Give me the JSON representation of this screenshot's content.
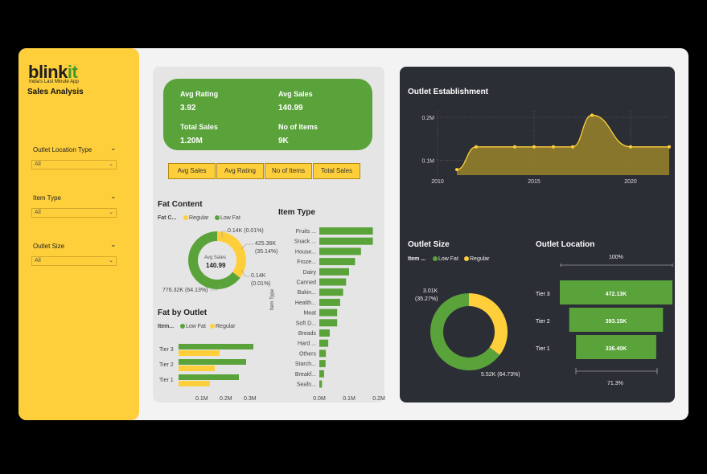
{
  "brand": {
    "logo_main": "blink",
    "logo_accent": "it",
    "tagline": "India's Last Minute App",
    "title": "Sales Analysis"
  },
  "slicers": [
    {
      "label": "Outlet Location Type",
      "value": "All"
    },
    {
      "label": "Item Type",
      "value": "All"
    },
    {
      "label": "Outlet Size",
      "value": "All"
    }
  ],
  "kpis": {
    "avg_rating_label": "Avg Rating",
    "avg_rating_value": "3.92",
    "avg_sales_label": "Avg Sales",
    "avg_sales_value": "140.99",
    "total_sales_label": "Total Sales",
    "total_sales_value": "1.20M",
    "no_items_label": "No of Items",
    "no_items_value": "9K"
  },
  "buttons": [
    "Avg Sales",
    "Avg Rating",
    "No of Items",
    "Total Sales"
  ],
  "colors": {
    "green": "#5aa33b",
    "yellow": "#fecf3b",
    "dark": "#2c2e36"
  },
  "fat_content": {
    "title": "Fat Content",
    "legend_title": "Fat C...",
    "center_label": "Avg Sales",
    "center_value": "140.99",
    "annotations": [
      "0.14K (0.01%)",
      "425.36K",
      "(35.14%)",
      "0.14K",
      "(0.01%)",
      "776.32K (64.13%)"
    ]
  },
  "fat_by_outlet": {
    "title": "Fat by Outlet",
    "legend_title": "Item..."
  },
  "item_type": {
    "title": "Item Type",
    "axis_title": "Item Type"
  },
  "outlet_establishment": {
    "title": "Outlet Establishment"
  },
  "outlet_size": {
    "title": "Outlet Size",
    "legend_title": "Item ...",
    "annotations": [
      "3.01K",
      "(35.27%)",
      "5.52K (64.73%)"
    ]
  },
  "outlet_location": {
    "title": "Outlet Location",
    "top_label": "100%",
    "bottom_label": "71.3%"
  },
  "legend": {
    "low_fat": "Low Fat",
    "regular": "Regular"
  },
  "chart_data": [
    {
      "type": "pie",
      "title": "Fat Content",
      "categories": [
        "Regular",
        "Low Fat"
      ],
      "values": [
        425.36,
        776.32
      ],
      "unit": "K"
    },
    {
      "type": "bar",
      "title": "Fat by Outlet",
      "categories": [
        "Tier 3",
        "Tier 2",
        "Tier 1"
      ],
      "series": [
        {
          "name": "Low Fat",
          "values": [
            0.31,
            0.28,
            0.25
          ]
        },
        {
          "name": "Regular",
          "values": [
            0.17,
            0.15,
            0.13
          ]
        }
      ],
      "xticks": [
        "0.1M",
        "0.2M",
        "0.3M"
      ],
      "xlim": [
        0,
        0.35
      ]
    },
    {
      "type": "bar",
      "title": "Item Type",
      "categories": [
        "Fruits ...",
        "Snack ...",
        "House...",
        "Froze...",
        "Dairy",
        "Canned",
        "Bakin...",
        "Health...",
        "Meat",
        "Soft D...",
        "Breads",
        "Hard ...",
        "Others",
        "Starch...",
        "Breakf...",
        "Seafo..."
      ],
      "values": [
        0.18,
        0.18,
        0.14,
        0.12,
        0.1,
        0.09,
        0.08,
        0.07,
        0.06,
        0.06,
        0.035,
        0.03,
        0.022,
        0.021,
        0.016,
        0.009
      ],
      "xticks": [
        "0.0M",
        "0.1M",
        "0.2M"
      ],
      "xlim": [
        0,
        0.2
      ]
    },
    {
      "type": "area",
      "title": "Outlet Establishment",
      "x": [
        2011,
        2012,
        2014,
        2015,
        2016,
        2017,
        2018,
        2020,
        2022
      ],
      "y": [
        0.078,
        0.131,
        0.131,
        0.131,
        0.131,
        0.131,
        0.205,
        0.131,
        0.131
      ],
      "xticks": [
        "2010",
        "2015",
        "2020"
      ],
      "yticks": [
        "0.1M",
        "0.2M"
      ],
      "xlim": [
        2010,
        2022
      ],
      "ylim": [
        0.065,
        0.215
      ]
    },
    {
      "type": "pie",
      "title": "Outlet Size",
      "categories": [
        "Regular",
        "Low Fat"
      ],
      "values": [
        3.01,
        5.52
      ],
      "unit": "K"
    },
    {
      "type": "bar",
      "title": "Outlet Location",
      "categories": [
        "Tier 3",
        "Tier 2",
        "Tier 1"
      ],
      "values": [
        472.13,
        393.15,
        336.4
      ],
      "labels": [
        "472.13K",
        "393.15K",
        "336.40K"
      ],
      "unit": "K"
    }
  ]
}
